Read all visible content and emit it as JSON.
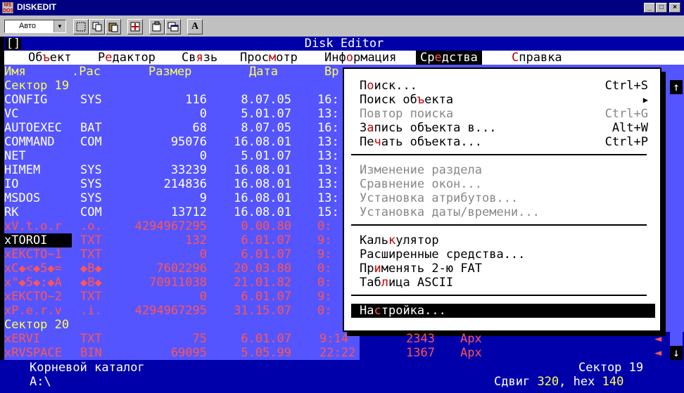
{
  "window": {
    "title": "DISKEDIT",
    "icon_text": "MS\nDOS",
    "btn_min": "_",
    "btn_max": "□",
    "btn_close": "×"
  },
  "toolbar": {
    "font_combo": "Авто",
    "combo_arrow": "▼",
    "font_button": "A"
  },
  "console": {
    "title": "Disk Editor",
    "bracket": "[]"
  },
  "menubar": [
    {
      "pre": "Об",
      "hot": "ъ",
      "post": "ект"
    },
    {
      "pre": "Р",
      "hot": "е",
      "post": "дактор"
    },
    {
      "pre": "Св",
      "hot": "я",
      "post": "зь"
    },
    {
      "pre": "Прос",
      "hot": "м",
      "post": "отр"
    },
    {
      "pre": "Инф",
      "hot": "о",
      "post": "рмация"
    },
    {
      "pre": "Ср",
      "hot": "е",
      "post": "дства"
    },
    {
      "pre": "",
      "hot": "С",
      "post": "правка"
    }
  ],
  "columns": {
    "name": "Имя",
    "ext": ".Рас",
    "size": "Размер",
    "date": "Дата",
    "time": "Вр"
  },
  "rows": [
    {
      "type": "sector",
      "name": "Сектор 19"
    },
    {
      "type": "file",
      "style": "w",
      "name": "CONFIG",
      "ext": "SYS",
      "size": "116",
      "date": "8.07.05",
      "time": "16:"
    },
    {
      "type": "file",
      "style": "w",
      "name": "VC",
      "ext": "",
      "size": "0",
      "date": "5.01.07",
      "time": "13:"
    },
    {
      "type": "file",
      "style": "w",
      "name": "AUTOEXEC",
      "ext": "BAT",
      "size": "68",
      "date": "8.07.05",
      "time": "16:"
    },
    {
      "type": "file",
      "style": "w",
      "name": "COMMAND",
      "ext": "COM",
      "size": "95076",
      "date": "16.08.01",
      "time": "13:"
    },
    {
      "type": "file",
      "style": "w",
      "name": "NET",
      "ext": "",
      "size": "0",
      "date": "5.01.07",
      "time": "13:"
    },
    {
      "type": "file",
      "style": "w",
      "name": "HIMEM",
      "ext": "SYS",
      "size": "33239",
      "date": "16.08.01",
      "time": "13:"
    },
    {
      "type": "file",
      "style": "w",
      "name": "IO",
      "ext": "SYS",
      "size": "214836",
      "date": "16.08.01",
      "time": "13:"
    },
    {
      "type": "file",
      "style": "w",
      "name": "MSDOS",
      "ext": "SYS",
      "size": "9",
      "date": "16.08.01",
      "time": "13:"
    },
    {
      "type": "file",
      "style": "w",
      "name": "RK",
      "ext": "COM",
      "size": "13712",
      "date": "16.08.01",
      "time": "15:"
    },
    {
      "type": "file",
      "style": "r",
      "name": "xV.t.o.r",
      "ext": ".o.",
      "size": "4294967295",
      "date": "0.00.80",
      "time": "0:"
    },
    {
      "type": "file",
      "style": "r",
      "selected": true,
      "name": "xTOROI",
      "ext": "TXT",
      "size": "132",
      "date": "6.01.07",
      "time": "9:"
    },
    {
      "type": "file",
      "style": "r",
      "name": "xEKCTO~1",
      "ext": "TXT",
      "size": "0",
      "date": "6.01.07",
      "time": "9:"
    },
    {
      "type": "file",
      "style": "r",
      "name": "xC◆<◆5◆=",
      "ext": "◆B◆",
      "size": "7602296",
      "date": "20.03.80",
      "time": "0:"
    },
    {
      "type": "file",
      "style": "r",
      "name": "x\"◆5◆:◆A",
      "ext": "◆B◆",
      "size": "70911038",
      "date": "21.01.82",
      "time": "0:"
    },
    {
      "type": "file",
      "style": "r",
      "name": "xEKCTO~2",
      "ext": "TXT",
      "size": "0",
      "date": "6.01.07",
      "time": "9:"
    },
    {
      "type": "file",
      "style": "r",
      "name": "xP.e.r.v",
      "ext": ".i.",
      "size": "4294967295",
      "date": "31.15.07",
      "time": "0:"
    },
    {
      "type": "sector",
      "name": "Сектор 20"
    },
    {
      "type": "file",
      "style": "r",
      "name": "xERVI",
      "ext": "TXT",
      "size": "75",
      "date": "6.01.07",
      "time": "9:14",
      "cluster": "2343",
      "attr": "Арх"
    },
    {
      "type": "file",
      "style": "r",
      "name": "xRVSPACE",
      "ext": "BIN",
      "size": "69095",
      "date": "5.05.99",
      "time": "22:22",
      "cluster": "1367",
      "attr": "Арх"
    }
  ],
  "row_marker": "◄",
  "scroll": {
    "up": "↑",
    "down": "↓"
  },
  "dropdown": {
    "items": [
      {
        "pre": "П",
        "hot": "о",
        "post": "иск...",
        "shortcut": "Ctrl+S",
        "disabled": false
      },
      {
        "pre": "Поиск об",
        "hot": "ъ",
        "post": "екта",
        "shortcut": "▶",
        "disabled": false
      },
      {
        "pre": "Повтор поиска",
        "hot": "",
        "post": "",
        "shortcut": "Ctrl+G",
        "disabled": true
      },
      {
        "pre": "З",
        "hot": "а",
        "post": "пись объекта в...",
        "shortcut": "Alt+W",
        "disabled": false
      },
      {
        "pre": "Пе",
        "hot": "ч",
        "post": "ать объекта...",
        "shortcut": "Ctrl+P",
        "disabled": false
      },
      {
        "sep": true
      },
      {
        "pre": "Изменение раздела",
        "hot": "",
        "post": "",
        "shortcut": "",
        "disabled": true
      },
      {
        "pre": "Сравнение окон...",
        "hot": "",
        "post": "",
        "shortcut": "",
        "disabled": true
      },
      {
        "pre": "Установка атрибутов...",
        "hot": "",
        "post": "",
        "shortcut": "",
        "disabled": true
      },
      {
        "pre": "Установка даты/времени...",
        "hot": "",
        "post": "",
        "shortcut": "",
        "disabled": true
      },
      {
        "sep": true
      },
      {
        "pre": "Каль",
        "hot": "к",
        "post": "улятор",
        "shortcut": "",
        "disabled": false
      },
      {
        "pre": "Расширенные средства...",
        "hot": "",
        "post": "",
        "shortcut": "",
        "disabled": false
      },
      {
        "pre": "Пр",
        "hot": "и",
        "post": "менять 2-ю FAT",
        "shortcut": "",
        "disabled": false
      },
      {
        "pre": "Таб",
        "hot": "л",
        "post": "ица ASCII",
        "shortcut": "",
        "disabled": false
      },
      {
        "sep": true
      },
      {
        "pre": "На",
        "hot": "с",
        "post": "тройка...",
        "shortcut": "",
        "disabled": false,
        "highlighted": true
      }
    ]
  },
  "status": {
    "left_top": "Корневой каталог",
    "left_bottom": "A:\\",
    "right_top": "Сектор 19",
    "shift_label": "Сдвиг",
    "shift_value": "320",
    "hex_label": ", hex",
    "hex_value": "140"
  }
}
